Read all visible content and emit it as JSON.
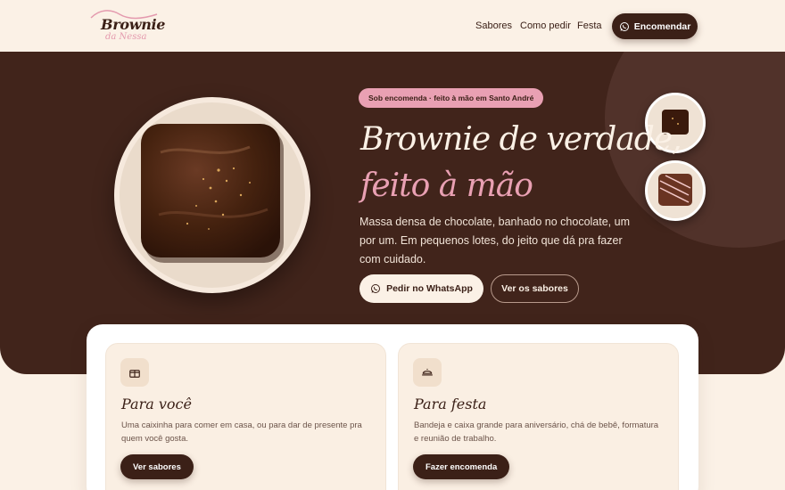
{
  "header": {
    "logo_main": "Brownie",
    "logo_sub": "da Nessa",
    "nav": [
      "Sabores",
      "Como pedir",
      "Festa"
    ],
    "order_button": "Encomendar"
  },
  "hero": {
    "tagline": "Sob encomenda · feito à mão em Santo André",
    "title_line1": "Brownie de verdade,",
    "title_line2": "feito à mão",
    "description": "Massa densa de chocolate, banhado no chocolate, um por um. Em pequenos lotes, do jeito que dá pra fazer com cuidado.",
    "whatsapp_button": "Pedir no WhatsApp",
    "flavors_button": "Ver os sabores"
  },
  "cards": [
    {
      "icon": "gift-box-icon",
      "title": "Para você",
      "text": "Uma caixinha para comer em casa, ou para dar de presente pra quem você gosta.",
      "button": "Ver sabores"
    },
    {
      "icon": "cake-icon",
      "title": "Para festa",
      "text": "Bandeja e caixa grande para aniversário, chá de bebê, formatura e reunião de trabalho.",
      "button": "Fazer encomenda"
    }
  ],
  "colors": {
    "brown_dark": "#41241b",
    "brown_text": "#3b2017",
    "pink_accent": "#e9a0b3",
    "cream": "#fbf1e6"
  }
}
